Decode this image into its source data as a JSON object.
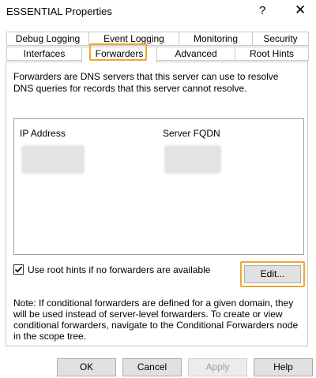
{
  "window": {
    "title": "ESSENTIAL Properties",
    "help_glyph": "?",
    "close_glyph": "✕"
  },
  "tabs": {
    "row1": [
      "Debug Logging",
      "Event Logging",
      "Monitoring",
      "Security"
    ],
    "row2": [
      "Interfaces",
      "Forwarders",
      "Advanced",
      "Root Hints"
    ],
    "active": "Forwarders"
  },
  "forwarders": {
    "description": "Forwarders are DNS servers that this server can use to resolve DNS queries for records that this server cannot resolve.",
    "columns": [
      "IP Address",
      "Server FQDN"
    ],
    "use_root_hints_label": "Use root hints if no forwarders are available",
    "use_root_hints_checked": true,
    "check_glyph": "✓",
    "edit_label": "Edit...",
    "note": "Note: If conditional forwarders are defined for a given domain, they will be used instead of server-level forwarders.  To create or view conditional forwarders, navigate to the Conditional Forwarders node in the scope tree."
  },
  "buttons": {
    "ok": "OK",
    "cancel": "Cancel",
    "apply": "Apply",
    "help": "Help"
  },
  "colors": {
    "highlight": "#f0a830",
    "button_face": "#e1e1e1",
    "disabled_text": "#a0a0a0"
  }
}
